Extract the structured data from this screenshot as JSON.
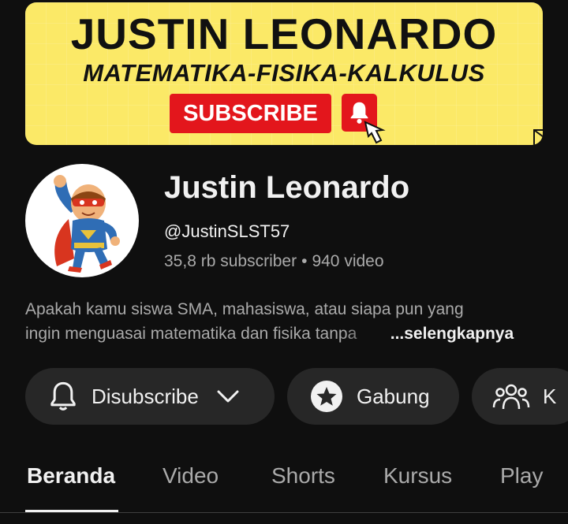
{
  "banner": {
    "title": "JUSTIN LEONARDO",
    "subtitle": "MATEMATIKA-FISIKA-KALKULUS",
    "subscribe_label": "SUBSCRIBE",
    "bg_color": "#fbe967",
    "accent_color": "#e3161c"
  },
  "channel": {
    "name": "Justin Leonardo",
    "handle": "@JustinSLST57",
    "subscribers": "35,8 rb subscriber",
    "separator": "•",
    "videos": "940 video",
    "avatar_icon": "superhero-avatar"
  },
  "description": {
    "line1": "Apakah kamu siswa SMA, mahasiswa, atau siapa pun yang",
    "line2": "ingin menguasai matematika dan fisika tan",
    "fade_text": "pa",
    "more_label": "...selengkapnya"
  },
  "actions": {
    "subscribe_label": "Disubscribe",
    "join_label": "Gabung",
    "community_label": "K"
  },
  "tabs": [
    {
      "label": "Beranda",
      "active": true
    },
    {
      "label": "Video",
      "active": false
    },
    {
      "label": "Shorts",
      "active": false
    },
    {
      "label": "Kursus",
      "active": false
    },
    {
      "label": "Play",
      "active": false
    }
  ]
}
